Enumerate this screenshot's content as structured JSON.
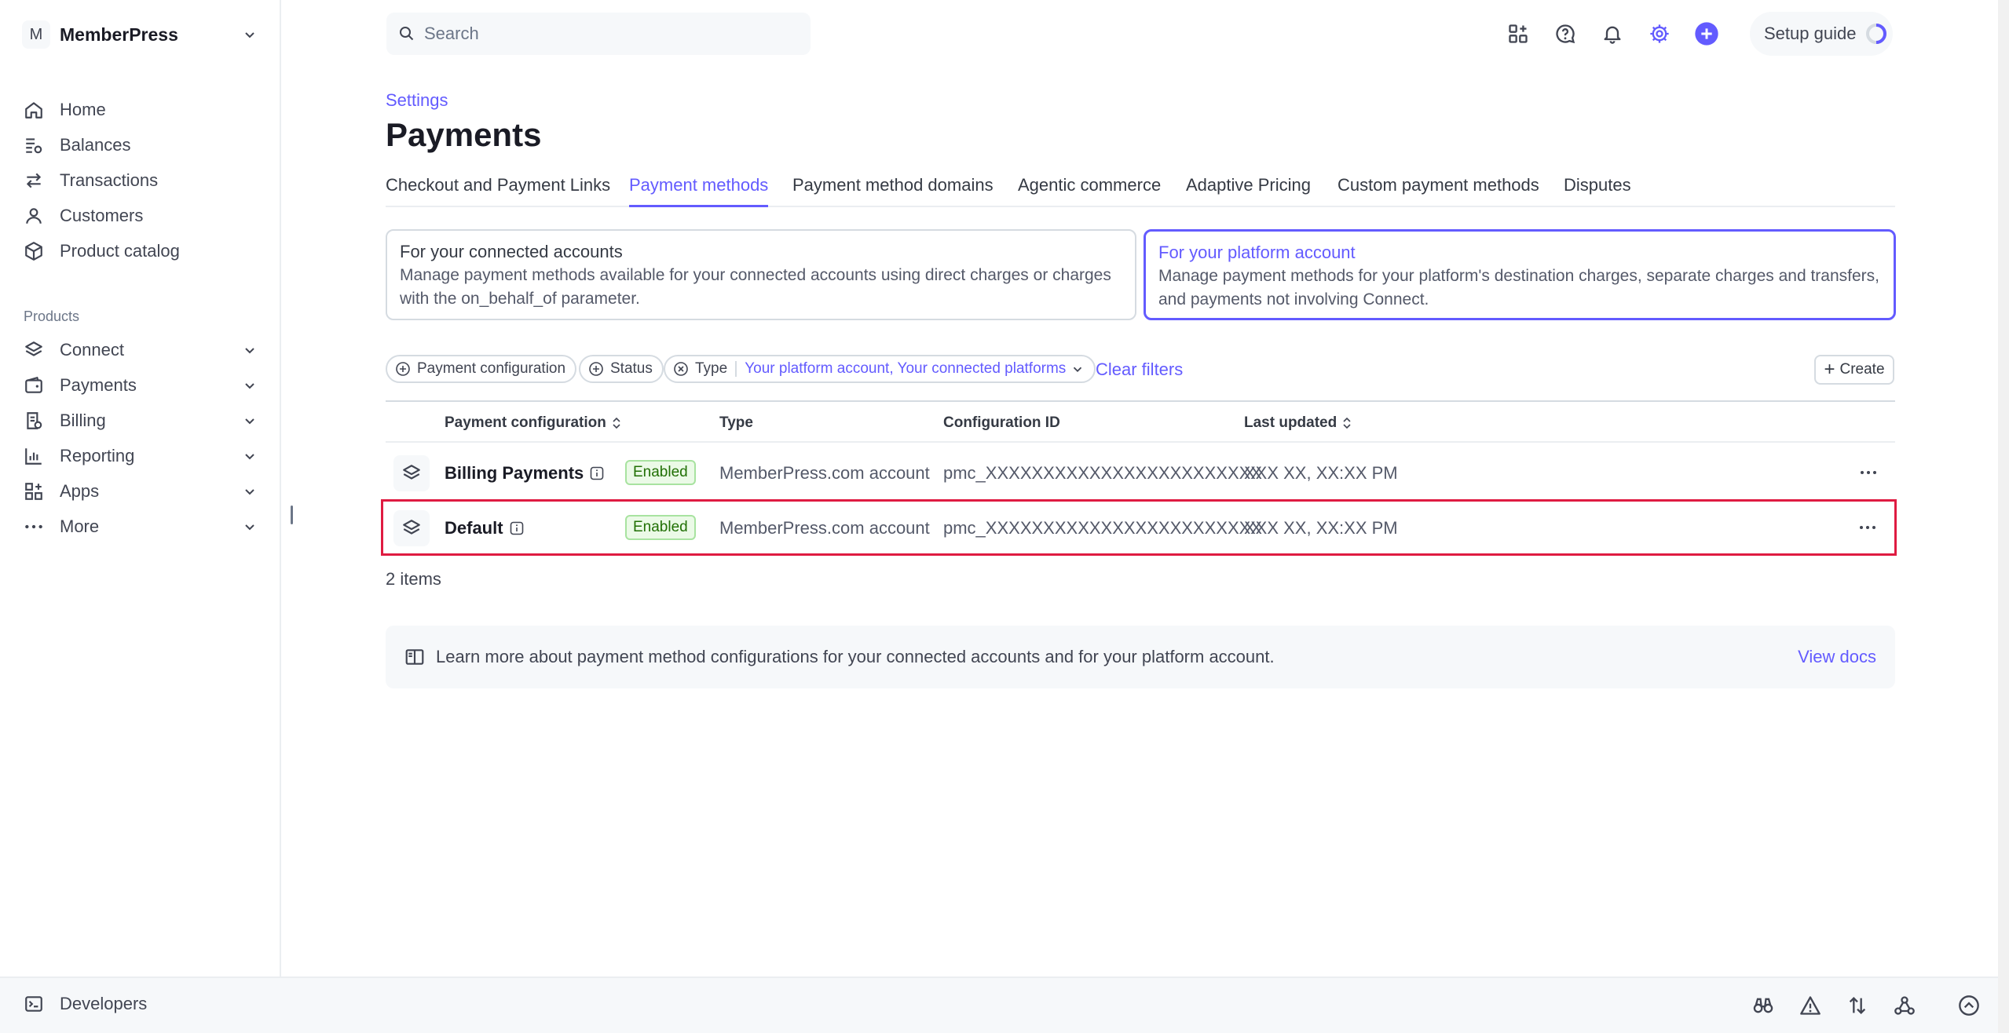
{
  "account": {
    "initial": "M",
    "name": "MemberPress"
  },
  "nav": {
    "items": [
      {
        "label": "Home",
        "icon": "home-icon"
      },
      {
        "label": "Balances",
        "icon": "balances-icon"
      },
      {
        "label": "Transactions",
        "icon": "transactions-icon"
      },
      {
        "label": "Customers",
        "icon": "customers-icon"
      },
      {
        "label": "Product catalog",
        "icon": "product-catalog-icon"
      }
    ],
    "products_label": "Products",
    "products": [
      {
        "label": "Connect",
        "icon": "connect-icon"
      },
      {
        "label": "Payments",
        "icon": "payments-icon"
      },
      {
        "label": "Billing",
        "icon": "billing-icon"
      },
      {
        "label": "Reporting",
        "icon": "reporting-icon"
      },
      {
        "label": "Apps",
        "icon": "apps-icon"
      },
      {
        "label": "More",
        "icon": "more-icon"
      }
    ]
  },
  "search": {
    "placeholder": "Search"
  },
  "setup_guide": "Setup guide",
  "breadcrumb": "Settings",
  "page_title": "Payments",
  "tabs": [
    "Checkout and Payment Links",
    "Payment methods",
    "Payment method domains",
    "Agentic commerce",
    "Adaptive Pricing",
    "Custom payment methods",
    "Disputes"
  ],
  "active_tab": "Payment methods",
  "cards": [
    {
      "title": "For your connected accounts",
      "desc": "Manage payment methods available for your connected accounts using direct charges or charges with the on_behalf_of parameter."
    },
    {
      "title": "For your platform account",
      "desc": "Manage payment methods for your platform's destination charges, separate charges and transfers, and payments not involving Connect."
    }
  ],
  "filters": {
    "payment_configuration": "Payment configuration",
    "status": "Status",
    "type": "Type",
    "type_value": "Your platform account, Your connected platforms",
    "clear": "Clear filters",
    "create": "Create"
  },
  "table": {
    "columns": [
      "Payment configuration",
      "Type",
      "Configuration ID",
      "Last updated"
    ],
    "rows": [
      {
        "name": "Billing Payments",
        "status": "Enabled",
        "type": "MemberPress.com account",
        "config_id": "pmc_XXXXXXXXXXXXXXXXXXXXXXXX",
        "updated": "XXX XX, XX:XX PM"
      },
      {
        "name": "Default",
        "status": "Enabled",
        "type": "MemberPress.com account",
        "config_id": "pmc_XXXXXXXXXXXXXXXXXXXXXXXX",
        "updated": "XXX XX, XX:XX PM"
      }
    ],
    "count": "2 items"
  },
  "banner": {
    "text": "Learn more about payment method configurations for your connected accounts and for your platform account.",
    "link": "View docs"
  },
  "developers": "Developers",
  "colors": {
    "accent": "#635bff",
    "highlight": "#df1b41",
    "success": "#217005"
  }
}
